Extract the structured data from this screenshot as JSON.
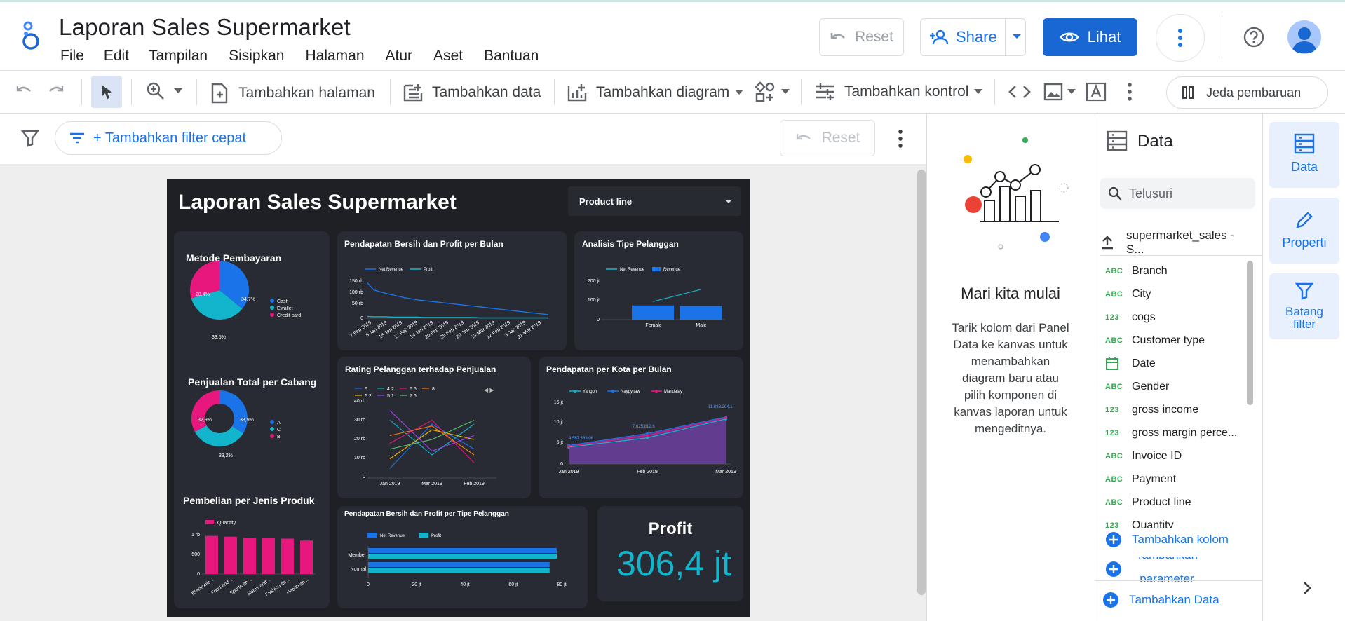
{
  "app": {
    "title": "Laporan Sales Supermarket"
  },
  "menu": [
    "File",
    "Edit",
    "Tampilan",
    "Sisipkan",
    "Halaman",
    "Atur",
    "Aset",
    "Bantuan"
  ],
  "header": {
    "reset": "Reset",
    "share": "Share",
    "view": "Lihat"
  },
  "toolbar": {
    "add_page": "Tambahkan halaman",
    "add_data": "Tambahkan data",
    "add_chart": "Tambahkan diagram",
    "add_control": "Tambahkan kontrol",
    "pause": "Jeda pembaruan"
  },
  "filterbar": {
    "quick_filter": "+ Tambahkan filter cepat",
    "reset": "Reset"
  },
  "report": {
    "title": "Laporan Sales Supermarket",
    "dropdown": "Product line",
    "pay": {
      "title": "Metode Pembayaran",
      "legend": [
        "Cash",
        "Ewallet",
        "Credit card"
      ],
      "labels": [
        "34,7%",
        "28,4%",
        "33,5%"
      ],
      "chart_data": {
        "type": "pie",
        "categories": [
          "Cash",
          "Ewallet",
          "Credit card"
        ],
        "values": [
          34.7,
          33.5,
          28.4
        ],
        "colors": [
          "#1a73e8",
          "#12b5cb",
          "#e8177e"
        ]
      }
    },
    "branch": {
      "title": "Penjualan Total per Cabang",
      "legend": [
        "A",
        "C",
        "B"
      ],
      "labels": [
        "32,9%",
        "33,9%",
        "33,2%"
      ],
      "chart_data": {
        "type": "pie",
        "categories": [
          "A",
          "C",
          "B"
        ],
        "values": [
          33.9,
          33.2,
          32.9
        ],
        "colors": [
          "#1a73e8",
          "#12b5cb",
          "#e8177e"
        ]
      }
    },
    "product": {
      "title": "Pembelian per Jenis Produk",
      "legend": "Quantity",
      "yticks": [
        "1 rb",
        "500",
        "0"
      ],
      "xticks": [
        "Electronic...",
        "Food and...",
        "Sports an...",
        "Home and...",
        "Fashion ac...",
        "Health an..."
      ],
      "chart_data": {
        "type": "bar",
        "categories": [
          "Electronic...",
          "Food and...",
          "Sports an...",
          "Home and...",
          "Fashion ac...",
          "Health an..."
        ],
        "values": [
          971,
          952,
          920,
          911,
          902,
          854
        ],
        "ylim": [
          0,
          1000
        ]
      }
    },
    "monthly": {
      "title": "Pendapatan Bersih dan Profit per Bulan",
      "legend": [
        "Net Revenue",
        "Profit"
      ],
      "yticks": [
        "150 rb",
        "100 rb",
        "50 rb",
        "0"
      ],
      "xticks": [
        "7 Feb 2019",
        "8 Jan 2019",
        "15 Jan 2019",
        "17 Feb 2019",
        "14 Jan 2019",
        "20 Feb 2019",
        "26 Feb 2019",
        "22 Jan 2019",
        "13 Mar 2019",
        "12 Feb 2019",
        "3 Jan 2019",
        "21 Mar 2019"
      ],
      "chart_data": {
        "type": "line",
        "series": [
          {
            "name": "Net Revenue",
            "values": [
              100,
              80,
              75,
              70,
              66,
              62,
              58,
              55,
              52,
              50,
              48,
              46,
              44,
              42,
              40,
              38,
              36,
              34,
              32,
              30,
              28,
              26,
              24,
              22,
              20,
              18,
              16,
              14,
              12,
              10
            ]
          },
          {
            "name": "Profit",
            "values": [
              5,
              4,
              4,
              4,
              3,
              3,
              3,
              3,
              3,
              2,
              2,
              2,
              2,
              2,
              2,
              2,
              2,
              2,
              1,
              1,
              1,
              1,
              1,
              1,
              1,
              1,
              1,
              1,
              1,
              1
            ]
          }
        ],
        "ylim": [
          0,
          150000
        ]
      }
    },
    "cust": {
      "title": "Analisis Tipe Pelanggan",
      "legend": [
        "Net Revenue",
        "Revenue"
      ],
      "yticks": [
        "200 jt",
        "100 jt",
        "0"
      ],
      "xticks": [
        "Female",
        "Male"
      ],
      "chart_data": {
        "type": "bar",
        "categories": [
          "Female",
          "Male"
        ],
        "series": [
          {
            "name": "Revenue",
            "values": [
              75,
              72
            ]
          },
          {
            "name": "Net Revenue",
            "values": [
              95,
              160
            ]
          }
        ],
        "ylim": [
          0,
          200
        ]
      }
    },
    "rating": {
      "title": "Rating Pelanggan terhadap Penjualan",
      "legend": [
        "6",
        "4.2",
        "6.6",
        "8",
        "6.2",
        "5.1",
        "7.6"
      ],
      "pager": "◀ ▶",
      "yticks": [
        "40 rb",
        "30 rb",
        "20 rb",
        "10 rb",
        "0"
      ],
      "xticks": [
        "Jan 2019",
        "Mar 2019",
        "Feb 2019"
      ],
      "chart_data": {
        "type": "line",
        "categories": [
          "Jan 2019",
          "Mar 2019",
          "Feb 2019"
        ],
        "series": [
          {
            "name": "6",
            "values": [
              5,
              28,
              15
            ]
          },
          {
            "name": "4.2",
            "values": [
              30,
              12,
              28
            ]
          },
          {
            "name": "6.6",
            "values": [
              18,
              30,
              8
            ]
          },
          {
            "name": "8",
            "values": [
              22,
              27,
              12
            ]
          },
          {
            "name": "6.2",
            "values": [
              10,
              25,
              20
            ]
          },
          {
            "name": "5.1",
            "values": [
              35,
              14,
              22
            ]
          },
          {
            "name": "7.6",
            "values": [
              15,
              20,
              30
            ]
          }
        ],
        "ylim": [
          0,
          40000
        ]
      }
    },
    "city": {
      "title": "Pendapatan per Kota per Bulan",
      "legend": [
        "Yangon",
        "Naypyitaw",
        "Mandalay"
      ],
      "yticks": [
        "15 jt",
        "10 jt",
        "5 jt",
        "0"
      ],
      "xticks": [
        "Jan 2019",
        "Feb 2019",
        "Mar 2019"
      ],
      "labels": [
        "4.567.368,06",
        "7.625.812,6",
        "11.688.204,1"
      ],
      "chart_data": {
        "type": "area",
        "categories": [
          "Jan 2019",
          "Feb 2019",
          "Mar 2019"
        ],
        "series": [
          {
            "name": "Yangon",
            "values": [
              4.2,
              6.5,
              11.2
            ]
          },
          {
            "name": "Naypyitaw",
            "values": [
              4.6,
              7.6,
              11.7
            ]
          },
          {
            "name": "Mandalay",
            "values": [
              4.4,
              7.1,
              11.5
            ]
          }
        ],
        "ylim": [
          0,
          15
        ]
      }
    },
    "typebar": {
      "title": "Pendapatan Bersih dan Profit per Tipe Pelanggan",
      "legend": [
        "Net Revenue",
        "Profit"
      ],
      "yticks": [
        "Member",
        "Normal"
      ],
      "xticks": [
        "0",
        "20 jt",
        "40 jt",
        "60 jt",
        "80 jt"
      ],
      "chart_data": {
        "type": "bar",
        "categories": [
          "Member",
          "Normal"
        ],
        "series": [
          {
            "name": "Net Revenue",
            "values": [
              78,
              75
            ]
          },
          {
            "name": "Profit",
            "values": [
              78,
              75
            ]
          }
        ],
        "xlim": [
          0,
          80
        ]
      }
    },
    "profit": {
      "title": "Profit",
      "value": "306,4 jt"
    }
  },
  "start": {
    "title": "Mari kita mulai",
    "lines": [
      "Tarik kolom dari Panel",
      "Data ke kanvas untuk",
      "menambahkan",
      "diagram baru atau",
      "pilih komponen di",
      "kanvas laporan untuk",
      "mengeditnya."
    ]
  },
  "data_panel": {
    "title": "Data",
    "search": "Telusuri",
    "source": "supermarket_sales - S...",
    "fields": [
      {
        "t": "ABC",
        "n": "Branch"
      },
      {
        "t": "ABC",
        "n": "City"
      },
      {
        "t": "123",
        "n": "cogs"
      },
      {
        "t": "ABC",
        "n": "Customer type"
      },
      {
        "t": "cal",
        "n": "Date"
      },
      {
        "t": "ABC",
        "n": "Gender"
      },
      {
        "t": "123",
        "n": "gross income"
      },
      {
        "t": "123",
        "n": "gross margin perce..."
      },
      {
        "t": "ABC",
        "n": "Invoice ID"
      },
      {
        "t": "ABC",
        "n": "Payment"
      },
      {
        "t": "ABC",
        "n": "Product line"
      },
      {
        "t": "123",
        "n": "Quantity"
      }
    ],
    "add_field": "Tambahkan kolom",
    "add_param": "Tambahkan parameter",
    "add_data": "Tambahkan Data"
  },
  "side_tabs": {
    "data": "Data",
    "props": "Properti",
    "filter1": "Batang",
    "filter2": "filter"
  },
  "colors": {
    "accent": "#1a73e8",
    "report_bg": "#1e2026",
    "card_bg": "#282b33",
    "pink": "#e8177e",
    "teal": "#12b5cb"
  }
}
